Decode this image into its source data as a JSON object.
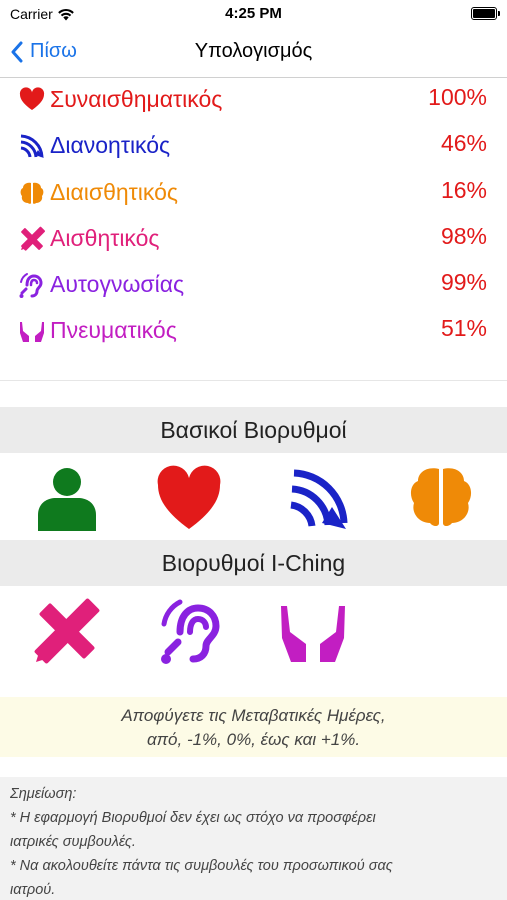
{
  "status": {
    "carrier": "Carrier",
    "time": "4:25 PM"
  },
  "nav": {
    "back_label": "Πίσω",
    "title": "Υπολογισμός"
  },
  "rows": [
    {
      "label": "Συναισθηματικός",
      "value": "100%",
      "color": "#e21a1a",
      "icon": "heart-icon"
    },
    {
      "label": "Διανοητικός",
      "value": "46%",
      "color": "#1a23c7",
      "icon": "satellite-dish-icon"
    },
    {
      "label": "Διαισθητικός",
      "value": "16%",
      "color": "#ef8a07",
      "icon": "brain-icon"
    },
    {
      "label": "Αισθητικός",
      "value": "98%",
      "color": "#e0207a",
      "icon": "pencil-ruler-icon"
    },
    {
      "label": "Αυτογνωσίας",
      "value": "99%",
      "color": "#8a22e0",
      "icon": "ear-listen-icon"
    },
    {
      "label": "Πνευματικός",
      "value": "51%",
      "color": "#c21ec2",
      "icon": "hands-icon"
    }
  ],
  "sections": {
    "basic_title": "Βασικοί Βιορυθμοί",
    "iching_title": "Βιορυθμοί I-Ching"
  },
  "colors": {
    "physical": "#0f7a1e",
    "emotional": "#e21a1a",
    "intellectual": "#1a23c7",
    "intuitive": "#ef8a07",
    "aesthetic": "#e0207a",
    "awareness": "#8a22e0",
    "spiritual": "#c21ec2",
    "value_text": "#e21a1a",
    "link": "#1a73e8"
  },
  "notice": {
    "line1": "Αποφύγετε τις Μεταβατικές Ημέρες,",
    "line2": "από, -1%, 0%, έως και +1%."
  },
  "note": {
    "title": "Σημείωση:",
    "line1": "* Η εφαρμογή Βιορυθμοί δεν έχει ως στόχο να προσφέρει",
    "line2": "ιατρικές συμβουλές.",
    "line3": "* Να ακολουθείτε πάντα τις συμβουλές του προσωπικού σας",
    "line4": "ιατρού."
  }
}
